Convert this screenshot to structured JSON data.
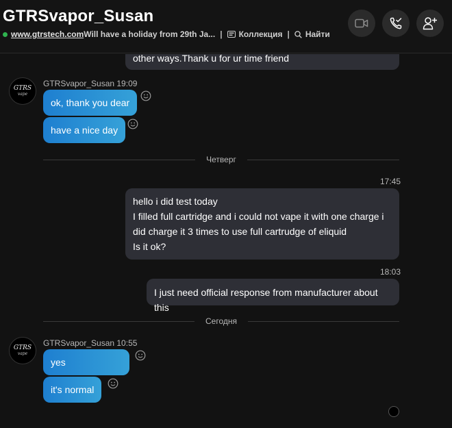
{
  "header": {
    "title": "GTRSvapor_Susan",
    "status_link": "www.gtrstech.com",
    "status_text": " Will have a holiday from 29th Ja...",
    "separator": "|",
    "collection_label": "Коллекция",
    "find_label": "Найти",
    "online_color": "#2fb34f",
    "buttons": [
      "video-call-icon",
      "audio-call-icon",
      "add-person-icon"
    ]
  },
  "contact": {
    "name": "GTRSvapor_Susan",
    "avatar_top": "GTRS",
    "avatar_bottom": "vape"
  },
  "messages": {
    "top_partial": "other ways.Thank u for ur time friend",
    "group1": {
      "meta": "GTRSvapor_Susan 19:09",
      "m1": "ok, thank you dear",
      "m2": "have a nice day"
    },
    "divider1": "Четверг",
    "out1": {
      "time": "17:45",
      "lines": [
        "hello i did test today",
        "I filled full cartridge and i could not vape it with one charge i",
        "did charge it 3 times to use full cartrudge of eliquid",
        "Is it ok?"
      ]
    },
    "out2": {
      "time": "18:03",
      "text": "I just need official response from manufacturer about this"
    },
    "divider2": "Сегодня",
    "group2": {
      "meta": "GTRSvapor_Susan 10:55",
      "m1": "yes",
      "m2": "it's normal"
    }
  },
  "colors": {
    "incoming_gradient_start": "#1e7fd0",
    "incoming_gradient_end": "#35a1d8",
    "outgoing_bubble": "#2e2f36",
    "background": "#121212"
  }
}
